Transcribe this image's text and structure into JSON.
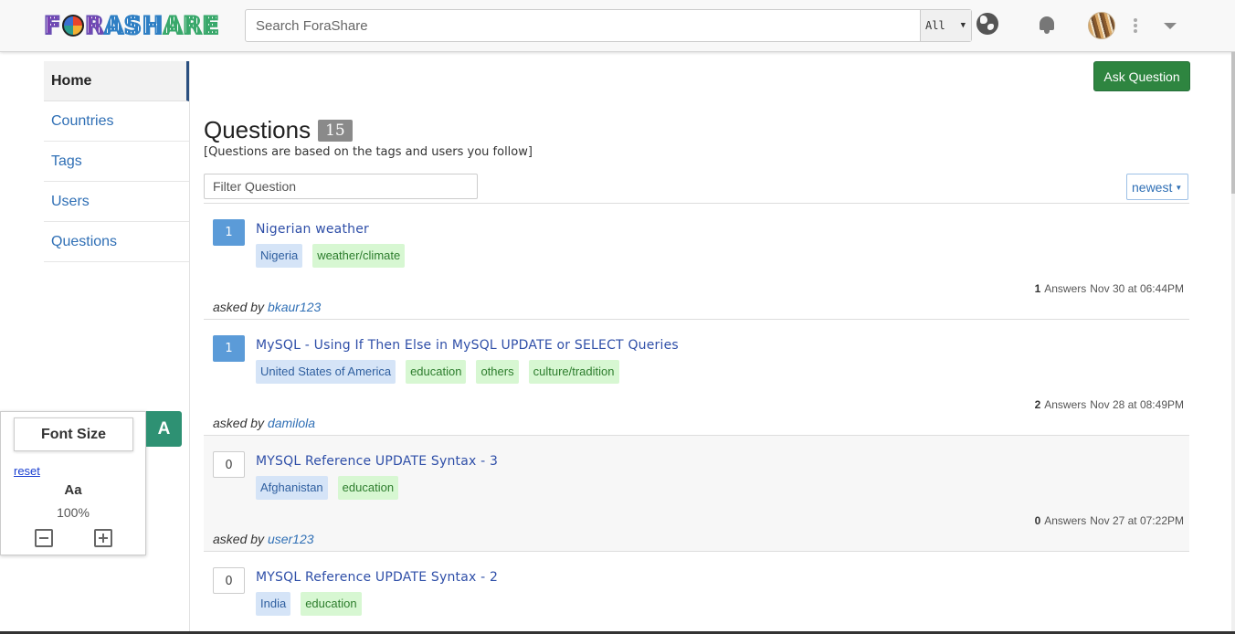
{
  "header": {
    "logo_text": "FORASHARE",
    "search_placeholder": "Search ForaShare",
    "search_scope": "All"
  },
  "sidebar": {
    "items": [
      {
        "label": "Home",
        "active": true
      },
      {
        "label": "Countries"
      },
      {
        "label": "Tags"
      },
      {
        "label": "Users"
      },
      {
        "label": "Questions"
      }
    ]
  },
  "main": {
    "ask_button": "Ask Question",
    "title": "Questions",
    "count": "15",
    "subtitle": "[Questions are based on the tags and users you follow]",
    "filter_placeholder": "Filter Question",
    "sort_label": "newest",
    "answers_label": "Answers",
    "asked_by_label": "asked by",
    "questions": [
      {
        "votes": "1",
        "title": "Nigerian weather",
        "tags": [
          {
            "text": "Nigeria",
            "kind": "country"
          },
          {
            "text": "weather/climate",
            "kind": "topic"
          }
        ],
        "answers": "1",
        "date": "Nov 30 at 06:44PM",
        "user": "bkaur123"
      },
      {
        "votes": "1",
        "title": "MySQL - Using If Then Else in MySQL UPDATE or SELECT Queries",
        "tags": [
          {
            "text": "United States of America",
            "kind": "country"
          },
          {
            "text": "education",
            "kind": "topic"
          },
          {
            "text": "others",
            "kind": "topic"
          },
          {
            "text": "culture/tradition",
            "kind": "topic"
          }
        ],
        "answers": "2",
        "date": "Nov 28 at 08:49PM",
        "user": "damilola"
      },
      {
        "votes": "0",
        "title": "MYSQL Reference UPDATE Syntax - 3",
        "tags": [
          {
            "text": "Afghanistan",
            "kind": "country"
          },
          {
            "text": "education",
            "kind": "topic"
          }
        ],
        "answers": "0",
        "date": "Nov 27 at 07:22PM",
        "user": "user123"
      },
      {
        "votes": "0",
        "title": "MYSQL Reference UPDATE Syntax - 2",
        "tags": [
          {
            "text": "India",
            "kind": "country"
          },
          {
            "text": "education",
            "kind": "topic"
          }
        ],
        "answers": "",
        "date": "",
        "user": ""
      }
    ]
  },
  "font_widget": {
    "title": "Font Size",
    "tab_letter": "A",
    "reset": "reset",
    "sample": "Aa",
    "level": "100%"
  },
  "colors": {
    "ask_button": "#2e8540",
    "link": "#2f6fb5",
    "vote_positive": "#5b9bd8",
    "country_tag": "#d5e4f7",
    "topic_tag": "#d7f7d2",
    "font_tab": "#2e9173"
  },
  "icons": [
    "globe-icon",
    "bell-icon",
    "kebab-menu-icon",
    "chevron-down-icon",
    "minus-icon",
    "plus-icon"
  ]
}
